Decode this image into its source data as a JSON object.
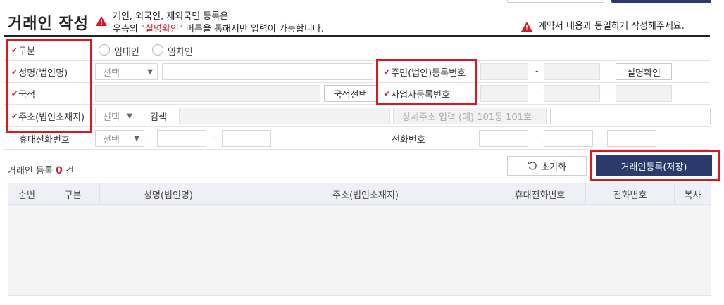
{
  "header": {
    "title": "거래인 작성",
    "notice_line1": "개인, 외국인, 재외국민 등록은",
    "notice_line2_prefix": "우측의 \"",
    "notice_line2_highlight": "실명확인",
    "notice_line2_suffix": "\" 버튼을 통해서만 입력이 가능합니다.",
    "right_notice": "계약서 내용과 동일하게 작성해주세요."
  },
  "form": {
    "type_label": "구분",
    "type_options": [
      "임대인",
      "임차인"
    ],
    "name_label": "성명(법인명)",
    "name_select": "선택",
    "nationality_label": "국적",
    "nationality_button": "국적선택",
    "address_label": "주소(법인소재지)",
    "address_select": "선택",
    "address_search_button": "검색",
    "address_detail_placeholder": "상세주소 입력 (예) 101동 101호",
    "mobile_label": "휴대전화번호",
    "mobile_select": "선택",
    "rrn_label": "주민(법인)등록번호",
    "verify_button": "실명확인",
    "biz_label": "사업자등록번호",
    "phone_label": "전화번호",
    "dash": "-"
  },
  "actions": {
    "reset_label": "초기화",
    "register_label": "거래인등록(저장)"
  },
  "list": {
    "title_prefix": "거래인 등록",
    "count": "0",
    "title_suffix": "건",
    "columns": [
      "순번",
      "구분",
      "성명(법인명)",
      "주소(법인소재지)",
      "휴대전화번호",
      "전화번호",
      "복사"
    ]
  },
  "colors": {
    "accent_red": "#d7182a",
    "primary_navy": "#2b3a6b",
    "highlight_border": "#e0161f"
  }
}
